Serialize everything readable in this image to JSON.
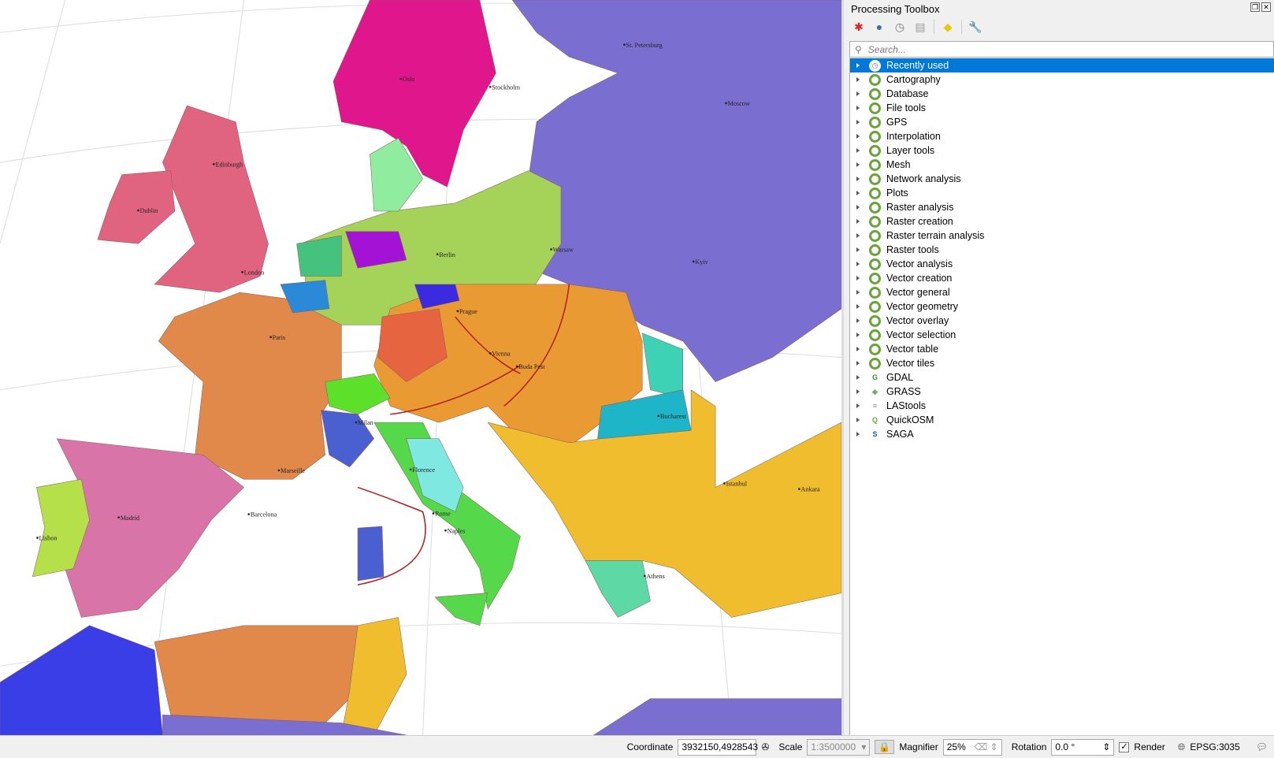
{
  "map": {
    "colors": {
      "russia": "#7a6fd0",
      "norway": "#e0168c",
      "france": "#e0894a",
      "spain": "#d874a7",
      "portugal": "#b5e04a",
      "uk": "#e0637f",
      "austria": "#e99a32",
      "ottoman": "#efbd2e",
      "italy": "#55d84a",
      "prussia": "#a5d35a",
      "africa_blue": "#3a3ee6",
      "sea": "#ffffff"
    },
    "cities": [
      "Oslo",
      "Stockholm",
      "St. Petersburg",
      "Moscow",
      "Edinburgh",
      "Dublin",
      "London",
      "Paris",
      "Madrid",
      "Lisbon",
      "Rome",
      "Vienna",
      "Berlin",
      "Warsaw",
      "Prague",
      "Buda Pest",
      "Istanbul",
      "Athens",
      "Naples",
      "Kyiv",
      "Ankara",
      "Bucharest",
      "Marseille",
      "Barcelona",
      "Florence",
      "Milan"
    ]
  },
  "panel": {
    "title": "Processing Toolbox",
    "toolbar_icons": [
      "models-gear-icon",
      "python-icon",
      "history-icon",
      "results-icon",
      "edit-in-place-icon",
      "options-wrench-icon"
    ],
    "search_placeholder": "Search...",
    "items": [
      {
        "label": "Recently used",
        "icon": "clock-icon",
        "selected": true
      },
      {
        "label": "Cartography",
        "icon": "qgis-icon"
      },
      {
        "label": "Database",
        "icon": "qgis-icon"
      },
      {
        "label": "File tools",
        "icon": "qgis-icon"
      },
      {
        "label": "GPS",
        "icon": "qgis-icon"
      },
      {
        "label": "Interpolation",
        "icon": "qgis-icon"
      },
      {
        "label": "Layer tools",
        "icon": "qgis-icon"
      },
      {
        "label": "Mesh",
        "icon": "qgis-icon"
      },
      {
        "label": "Network analysis",
        "icon": "qgis-icon"
      },
      {
        "label": "Plots",
        "icon": "qgis-icon"
      },
      {
        "label": "Raster analysis",
        "icon": "qgis-icon"
      },
      {
        "label": "Raster creation",
        "icon": "qgis-icon"
      },
      {
        "label": "Raster terrain analysis",
        "icon": "qgis-icon"
      },
      {
        "label": "Raster tools",
        "icon": "qgis-icon"
      },
      {
        "label": "Vector analysis",
        "icon": "qgis-icon"
      },
      {
        "label": "Vector creation",
        "icon": "qgis-icon"
      },
      {
        "label": "Vector general",
        "icon": "qgis-icon"
      },
      {
        "label": "Vector geometry",
        "icon": "qgis-icon"
      },
      {
        "label": "Vector overlay",
        "icon": "qgis-icon"
      },
      {
        "label": "Vector selection",
        "icon": "qgis-icon"
      },
      {
        "label": "Vector table",
        "icon": "qgis-icon"
      },
      {
        "label": "Vector tiles",
        "icon": "qgis-icon"
      },
      {
        "label": "GDAL",
        "icon": "gdal-icon"
      },
      {
        "label": "GRASS",
        "icon": "grass-icon"
      },
      {
        "label": "LAStools",
        "icon": "lastools-icon"
      },
      {
        "label": "QuickOSM",
        "icon": "quickosm-icon"
      },
      {
        "label": "SAGA",
        "icon": "saga-icon"
      }
    ]
  },
  "status": {
    "coordinate_label": "Coordinate",
    "coordinate_value": "3932150,4928543",
    "scale_label": "Scale",
    "scale_value": "1:3500000",
    "magnifier_label": "Magnifier",
    "magnifier_value": "25%",
    "rotation_label": "Rotation",
    "rotation_value": "0.0 °",
    "render_label": "Render",
    "render_checked": true,
    "crs": "EPSG:3035"
  }
}
